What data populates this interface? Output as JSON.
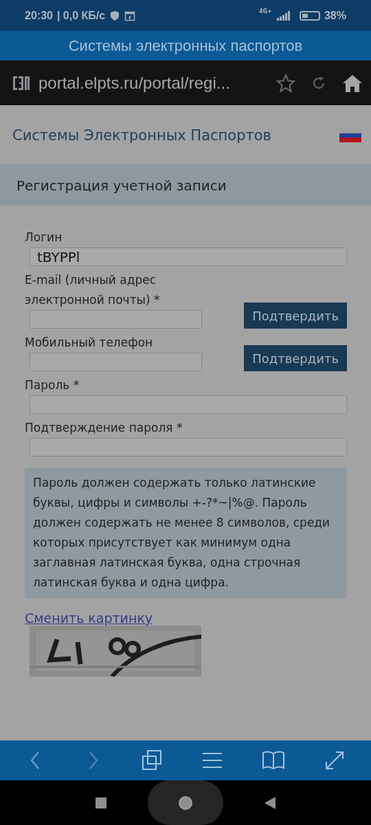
{
  "status_bar": {
    "time": "20:30",
    "speed": "| 0,0 КБ/с",
    "network": "4G+",
    "battery": "38%"
  },
  "app_title": "Системы электронных паспортов",
  "browser": {
    "url": "portal.elpts.ru/portal/regi...",
    "bookmarked": false
  },
  "site": {
    "title": "Системы Электронных Паспортов"
  },
  "section_title": "Регистрация учетной записи",
  "form": [
    {
      "kind": "field",
      "label": "Логин",
      "value": "tBYPPl"
    },
    {
      "kind": "field_button",
      "label": "E-mail (личный адрес электронной почты) *",
      "button": "Подтвердить"
    },
    {
      "kind": "field_button",
      "label": "Мобильный телефон",
      "button": "Подтвердить"
    },
    {
      "kind": "field",
      "label": "Пароль *"
    },
    {
      "kind": "field",
      "label": "Подтверждение пароля *"
    }
  ],
  "hint": "Пароль должен содержать только латинские буквы, цифры и символы +-?*~|%@. Пароль должен содержать не менее 8 символов, среди которых присутствует как минимум одна заглавная латинская буква, одна строчная латинская буква и одна цифра.",
  "captcha": {
    "link": "Сменить картинку",
    "kind": "picture"
  }
}
